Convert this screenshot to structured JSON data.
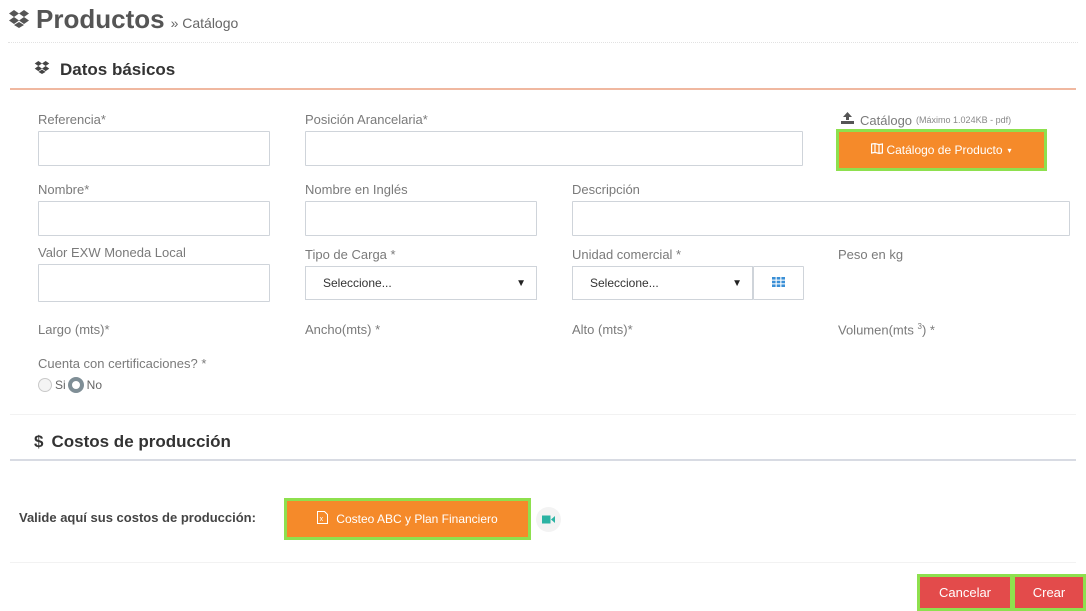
{
  "header": {
    "title": "Productos",
    "breadcrumb": "» Catálogo"
  },
  "datos_basicos": {
    "heading": "Datos básicos",
    "referencia_label": "Referencia*",
    "posicion_label": "Posición Arancelaria*",
    "catalogo_label": "Catálogo",
    "catalogo_hint": "(Máximo 1.024KB - pdf)",
    "catalogo_button": "Catálogo de Producto",
    "nombre_label": "Nombre*",
    "nombre_ingles_label": "Nombre en Inglés",
    "descripcion_label": "Descripción",
    "valor_exw_label": "Valor EXW Moneda Local",
    "tipo_carga_label": "Tipo de Carga *",
    "tipo_carga_value": "Seleccione...",
    "unidad_comercial_label": "Unidad comercial *",
    "unidad_comercial_value": "Seleccione...",
    "peso_label": "Peso en kg",
    "largo_label": "Largo (mts)*",
    "ancho_label": "Ancho(mts) *",
    "alto_label": "Alto (mts)*",
    "volumen_label": "Volumen(mts",
    "volumen_sup": "3",
    "volumen_suffix": ") *",
    "certificaciones_label": "Cuenta con certificaciones? *",
    "radio_si": "Si",
    "radio_no": "No",
    "selected": "No"
  },
  "costos": {
    "heading": "Costos de producción",
    "valide_label": "Valide aquí sus costos de producción:",
    "costeo_button": "Costeo ABC y Plan Financiero"
  },
  "actions": {
    "cancel": "Cancelar",
    "create": "Crear"
  },
  "colors": {
    "orange": "#f58a2a",
    "red": "#e34b4b",
    "highlight": "#8ee04e",
    "teal": "#2bb3a3"
  },
  "icons": [
    "dropbox-icon",
    "upload-icon",
    "map-icon",
    "grid-icon",
    "dollar-icon",
    "excel-icon",
    "video-camera-icon",
    "caret-down-icon"
  ]
}
